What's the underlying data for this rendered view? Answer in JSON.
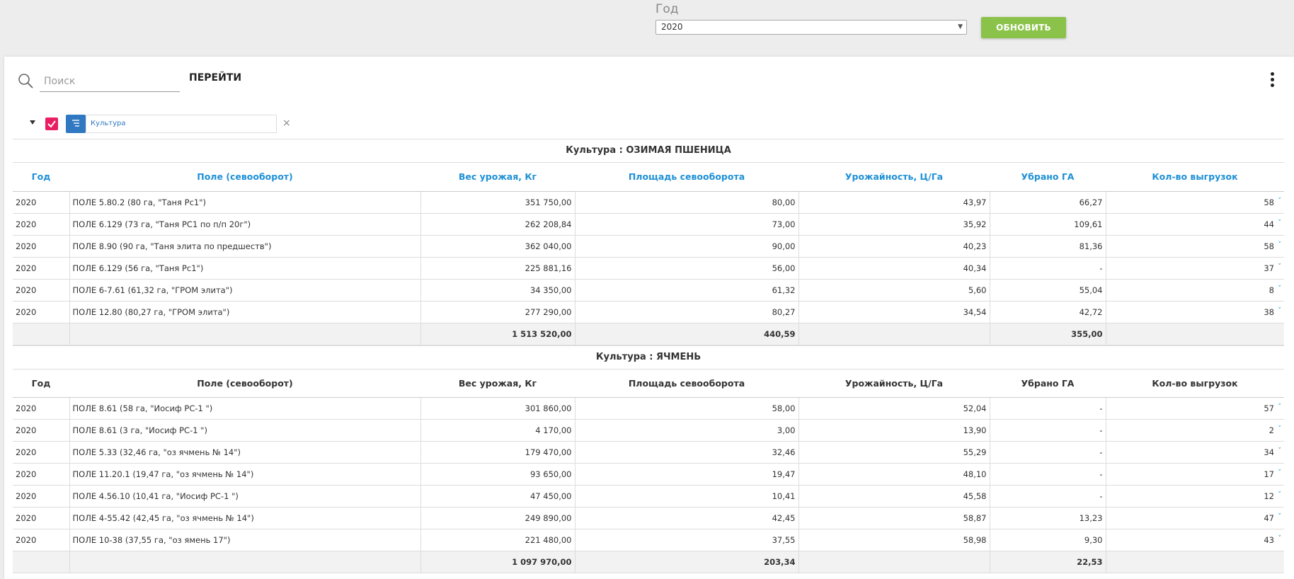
{
  "filter": {
    "year_label": "Год",
    "year_value": "2020",
    "refresh_label": "ОБНОВИТЬ"
  },
  "toolbar": {
    "search_placeholder": "Поиск",
    "goto_label": "ПЕРЕЙТИ"
  },
  "grouping": {
    "field_label": "Культура"
  },
  "columns": [
    "Год",
    "Поле (севооборот)",
    "Вес урожая, Кг",
    "Площадь севооборота",
    "Урожайность, Ц/Га",
    "Убрано ГА",
    "Кол-во выгрузок"
  ],
  "groups": [
    {
      "title": "Культура : ОЗИМАЯ ПШЕНИЦА",
      "rows": [
        [
          "2020",
          "ПОЛЕ 5.80.2 (80 га, \"Таня Рс1\")",
          "351 750,00",
          "80,00",
          "43,97",
          "66,27",
          "58"
        ],
        [
          "2020",
          "ПОЛЕ 6.129 (73 га, \"Таня РС1 по п/п 20г\")",
          "262 208,84",
          "73,00",
          "35,92",
          "109,61",
          "44"
        ],
        [
          "2020",
          "ПОЛЕ 8.90 (90 га, \"Таня элита по предшеств\")",
          "362 040,00",
          "90,00",
          "40,23",
          "81,36",
          "58"
        ],
        [
          "2020",
          "ПОЛЕ 6.129 (56 га, \"Таня Рс1\")",
          "225 881,16",
          "56,00",
          "40,34",
          "-",
          "37"
        ],
        [
          "2020",
          "ПОЛЕ 6-7.61 (61,32 га, \"ГРОМ элита\")",
          "34 350,00",
          "61,32",
          "5,60",
          "55,04",
          "8"
        ],
        [
          "2020",
          "ПОЛЕ 12.80 (80,27 га, \"ГРОМ элита\")",
          "277 290,00",
          "80,27",
          "34,54",
          "42,72",
          "38"
        ]
      ],
      "totals": [
        "",
        "",
        "1 513 520,00",
        "440,59",
        "",
        "355,00",
        ""
      ]
    },
    {
      "title": "Культура : ЯЧМЕНЬ",
      "rows": [
        [
          "2020",
          "ПОЛЕ 8.61 (58 га, \"Иосиф РС-1 \")",
          "301 860,00",
          "58,00",
          "52,04",
          "-",
          "57"
        ],
        [
          "2020",
          "ПОЛЕ 8.61 (3 га, \"Иосиф РС-1 \")",
          "4 170,00",
          "3,00",
          "13,90",
          "-",
          "2"
        ],
        [
          "2020",
          "ПОЛЕ 5.33 (32,46 га, \"оз ячмень № 14\")",
          "179 470,00",
          "32,46",
          "55,29",
          "-",
          "34"
        ],
        [
          "2020",
          "ПОЛЕ 11.20.1 (19,47 га, \"оз ячмень № 14\")",
          "93 650,00",
          "19,47",
          "48,10",
          "-",
          "17"
        ],
        [
          "2020",
          "ПОЛЕ 4.56.10 (10,41 га, \"Иосиф РС-1 \")",
          "47 450,00",
          "10,41",
          "45,58",
          "-",
          "12"
        ],
        [
          "2020",
          "ПОЛЕ 4-55.42 (42,45 га, \"оз ячмень № 14\")",
          "249 890,00",
          "42,45",
          "58,87",
          "13,23",
          "47"
        ],
        [
          "2020",
          "ПОЛЕ 10-38 (37,55 га, \"оз ямень 17\")",
          "221 480,00",
          "37,55",
          "58,98",
          "9,30",
          "43"
        ]
      ],
      "totals": [
        "",
        "",
        "1 097 970,00",
        "203,34",
        "",
        "22,53",
        ""
      ]
    }
  ],
  "colors": {
    "accent_green": "#8bc34a",
    "header_blue": "#1e90d6",
    "chip_blue": "#3079c2",
    "checkbox_pink": "#e91e63"
  }
}
